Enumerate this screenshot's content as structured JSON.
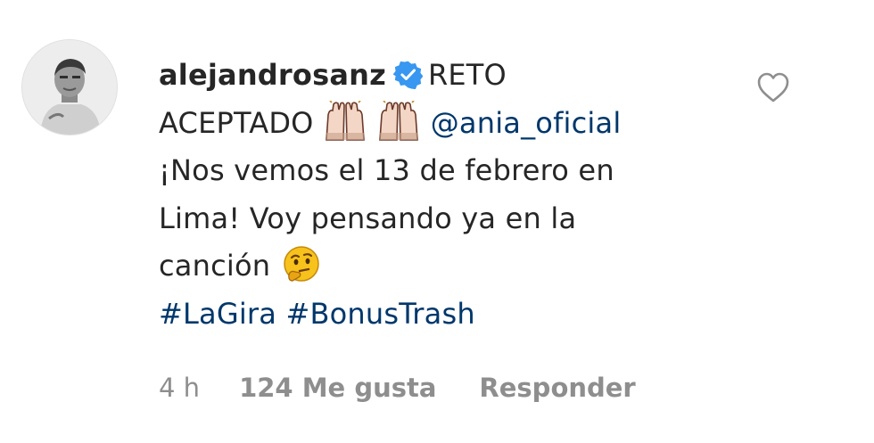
{
  "comment": {
    "username": "alejandrosanz",
    "text_part1": "RETO",
    "text_part2": "ACEPTADO",
    "mention": "@ania_oficial",
    "text_line3": "¡Nos vemos el 13 de febrero en",
    "text_line4": "Lima! Voy pensando ya en la",
    "text_line5": "canción",
    "hashtag1": "#LaGira",
    "hashtag2": "#BonusTrash",
    "emojis": [
      "raising-hands-emoji",
      "raising-hands-emoji",
      "thinking-face-emoji"
    ]
  },
  "meta": {
    "time": "4 h",
    "likes": "124 Me gusta",
    "reply": "Responder"
  },
  "colors": {
    "text": "#262626",
    "link": "#00376b",
    "meta": "#8e8e8e",
    "verified": "#3897f0"
  }
}
